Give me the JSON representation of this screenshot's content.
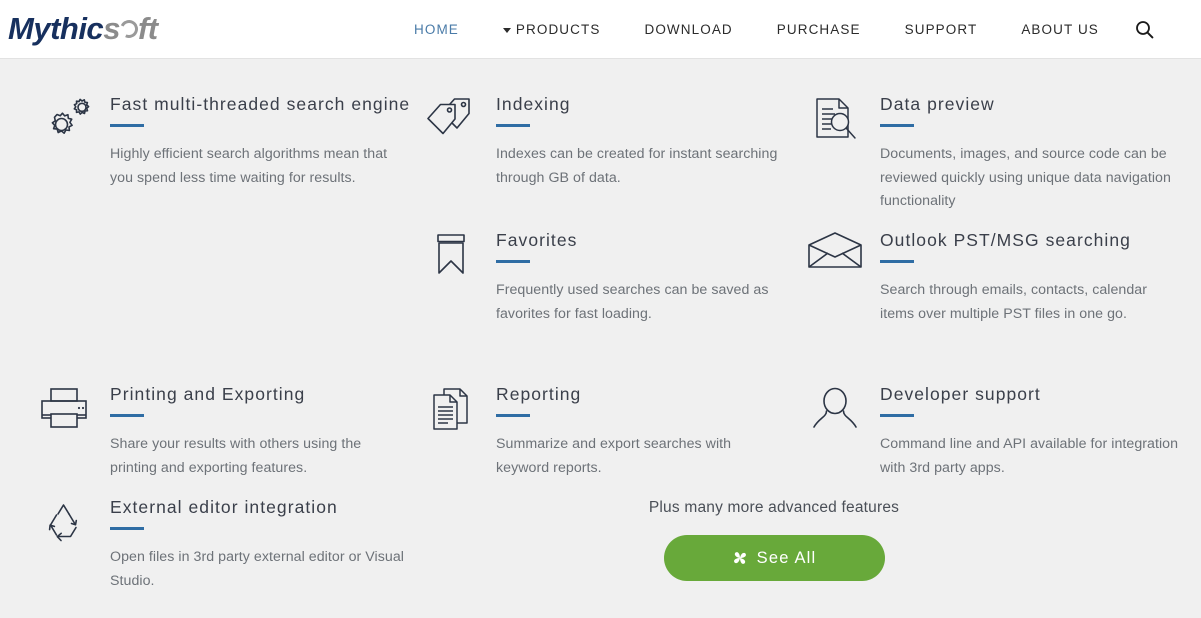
{
  "header": {
    "logo": {
      "part1": "Mythic",
      "part2": "s",
      "part3": "ft",
      "icon": "ring-o-icon"
    },
    "nav": [
      {
        "label": "HOME",
        "active": true,
        "caret": false
      },
      {
        "label": "PRODUCTS",
        "active": false,
        "caret": true
      },
      {
        "label": "DOWNLOAD",
        "active": false,
        "caret": false
      },
      {
        "label": "PURCHASE",
        "active": false,
        "caret": false
      },
      {
        "label": "SUPPORT",
        "active": false,
        "caret": false
      },
      {
        "label": "ABOUT US",
        "active": false,
        "caret": false
      }
    ],
    "search_icon": "search-icon"
  },
  "features": {
    "column1": [
      {
        "icon": "gears-icon",
        "title": "Fast multi-threaded search engine",
        "body": "Highly efficient search algorithms mean that you spend less time waiting for results."
      },
      {
        "icon": "printer-icon",
        "title": "Printing and Exporting",
        "body": "Share your results with others using the printing and exporting features."
      },
      {
        "icon": "recycle-icon",
        "title": "External editor integration",
        "body": "Open files in 3rd party external editor or Visual Studio."
      }
    ],
    "column2": [
      {
        "icon": "tags-icon",
        "title": "Indexing",
        "body": "Indexes can be created for instant searching through GB of data."
      },
      {
        "icon": "bookmark-icon",
        "title": "Favorites",
        "body": "Frequently used searches can be saved as favorites for fast loading."
      },
      {
        "icon": "report-documents-icon",
        "title": "Reporting",
        "body": "Summarize and export searches with keyword reports."
      }
    ],
    "column3": [
      {
        "icon": "document-magnifier-icon",
        "title": "Data preview",
        "body": "Documents, images, and source code can be reviewed quickly using unique data navigation functionality"
      },
      {
        "icon": "envelope-icon",
        "title": "Outlook PST/MSG searching",
        "body": "Search through emails, contacts, calendar items over multiple PST files in one go."
      },
      {
        "icon": "person-icon",
        "title": "Developer support",
        "body": "Command line and API available for integration with 3rd party apps."
      }
    ]
  },
  "cta": {
    "text": "Plus many more advanced features",
    "button_label": "See All",
    "button_icon": "pinwheel-icon"
  },
  "colors": {
    "accent_blue": "#2f6da4",
    "cta_green": "#68a93a",
    "logo_navy": "#17305e",
    "logo_gray": "#8b8b8b",
    "page_bg": "#f0f0f0",
    "header_bg": "#ffffff",
    "title_text": "#3a3f4a",
    "body_text": "#6d7278"
  }
}
